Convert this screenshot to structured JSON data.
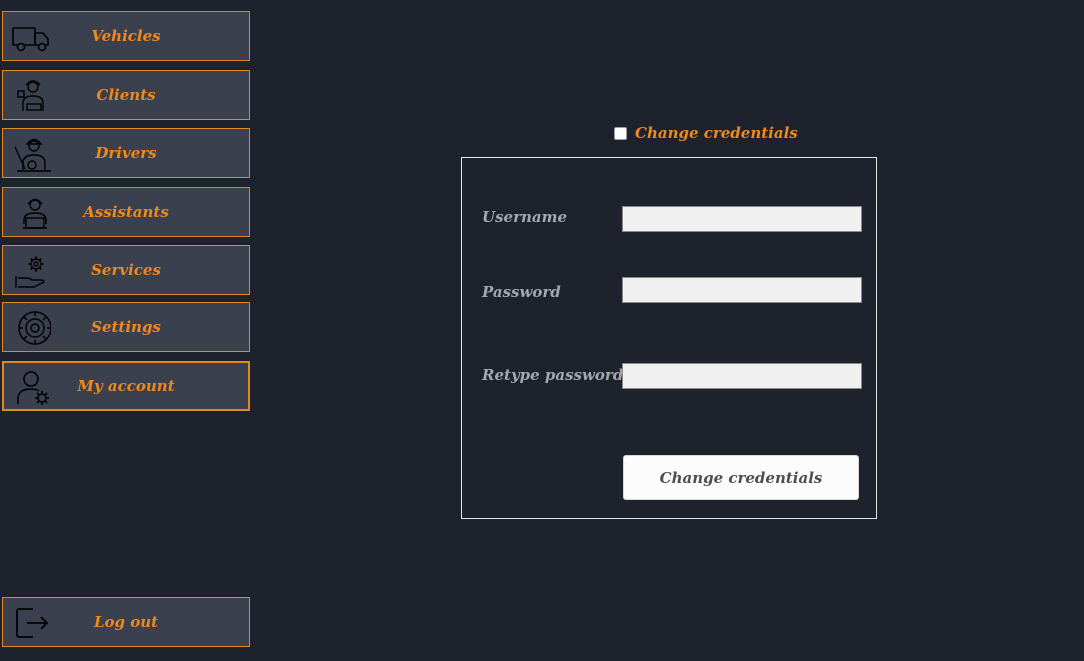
{
  "sidebar": {
    "items": [
      {
        "label": "Vehicles",
        "icon": "truck-icon"
      },
      {
        "label": "Clients",
        "icon": "client-icon"
      },
      {
        "label": "Drivers",
        "icon": "driver-icon"
      },
      {
        "label": "Assistants",
        "icon": "assistant-icon"
      },
      {
        "label": "Services",
        "icon": "service-icon"
      },
      {
        "label": "Settings",
        "icon": "gear-icon"
      },
      {
        "label": "My account",
        "icon": "user-gear-icon",
        "active": true
      }
    ],
    "logout": {
      "label": "Log out",
      "icon": "logout-icon"
    }
  },
  "form": {
    "checkbox_label": "Change credentials",
    "checkbox_checked": false,
    "username_label": "Username",
    "username_value": "",
    "password_label": "Password",
    "password_value": "",
    "retype_label": "Retype password",
    "retype_value": "",
    "submit_label": "Change credentials"
  },
  "colors": {
    "background": "#1d222c",
    "button_bg": "#3a404e",
    "accent": "#f0891a",
    "label_gray": "#a4a8ae"
  }
}
